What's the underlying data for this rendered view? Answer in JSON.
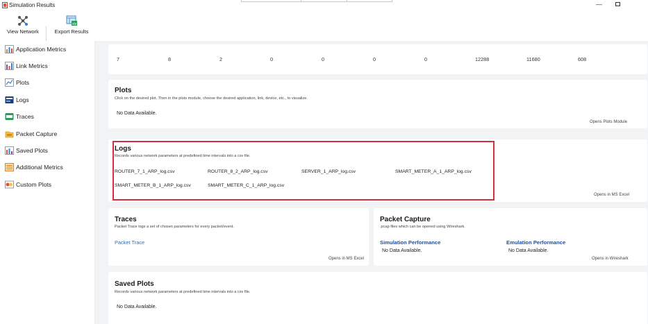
{
  "window": {
    "title": "Simulation Results"
  },
  "toolbar": {
    "view_network": "View Network",
    "export_results": "Export Results"
  },
  "sidebar": {
    "items": [
      {
        "label": "Application Metrics",
        "icon": "application-metrics-icon"
      },
      {
        "label": "Link Metrics",
        "icon": "link-metrics-icon"
      },
      {
        "label": "Plots",
        "icon": "plots-icon"
      },
      {
        "label": "Logs",
        "icon": "logs-icon"
      },
      {
        "label": "Traces",
        "icon": "traces-icon"
      },
      {
        "label": "Packet Capture",
        "icon": "packet-capture-icon"
      },
      {
        "label": "Saved Plots",
        "icon": "saved-plots-icon"
      },
      {
        "label": "Additional Metrics",
        "icon": "additional-metrics-icon"
      },
      {
        "label": "Custom Plots",
        "icon": "custom-plots-icon"
      }
    ]
  },
  "metrics_row": {
    "values": [
      "7",
      "8",
      "2",
      "0",
      "0",
      "0",
      "0",
      "12288",
      "11680",
      "608"
    ]
  },
  "plots": {
    "title": "Plots",
    "subtitle": "Click on the desired plot. Then in the plots module, choose the desired application, link, device, etc., to visualize.",
    "empty": "No Data Available.",
    "opens": "Opens Plots Module"
  },
  "logs": {
    "title": "Logs",
    "subtitle": "Records various network parameters at predefined time intervals into a csv file.",
    "files": [
      "ROUTER_7_1_ARP_log.csv",
      "ROUTER_8_2_ARP_log.csv",
      "SERVER_1_ARP_log.csv",
      "SMART_METER_A_1_ARP_log.csv",
      "SMART_METER_B_1_ARP_log.csv",
      "SMART_METER_C_1_ARP_log.csv"
    ],
    "opens": "Opens in MS Excel"
  },
  "traces": {
    "title": "Traces",
    "subtitle": "Packet Trace logs a set of chosen parameters for every packet/event.",
    "link": "Packet Trace",
    "opens": "Opens in MS Excel"
  },
  "packet_capture": {
    "title": "Packet Capture",
    "subtitle": ".pcap files which can be opened using Wireshark.",
    "simulation_heading": "Simulation Performance",
    "emulation_heading": "Emulation Performance",
    "simulation_empty": "No Data Available.",
    "emulation_empty": "No Data Available.",
    "opens": "Opens in Wireshark"
  },
  "saved_plots": {
    "title": "Saved Plots",
    "subtitle": "Records various network parameters at predefined time intervals into a csv file.",
    "empty": "No Data Available."
  },
  "colors": {
    "highlight": "#d32f3a",
    "link_blue": "#2f6eb5",
    "heading_blue": "#1f4e9c",
    "background": "#f2f3f5"
  }
}
